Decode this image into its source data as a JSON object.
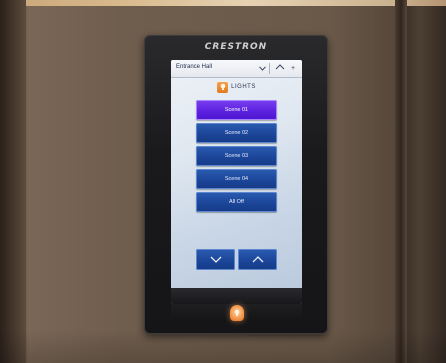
{
  "device": {
    "brand": "CRESTRON"
  },
  "topbar": {
    "room_name": "Entrance Hall",
    "chevron_icon": "chevron-down-icon",
    "home_icon": "home-icon",
    "more_label": "+"
  },
  "section": {
    "icon": "lightbulb-icon",
    "title": "LIGHTS"
  },
  "scenes": [
    {
      "label": "Scene 01",
      "active": true
    },
    {
      "label": "Scene 02",
      "active": false
    },
    {
      "label": "Scene 03",
      "active": false
    },
    {
      "label": "Scene 04",
      "active": false
    },
    {
      "label": "All Off",
      "active": false
    }
  ],
  "controls": {
    "down_icon": "chevron-down-icon",
    "up_icon": "chevron-up-icon"
  },
  "hardware": {
    "home_key_icon": "lightbulb-icon"
  },
  "colors": {
    "scene_button": "#1c469a",
    "active_scene": "#5d22e0",
    "accent_orange": "#e07a23"
  }
}
